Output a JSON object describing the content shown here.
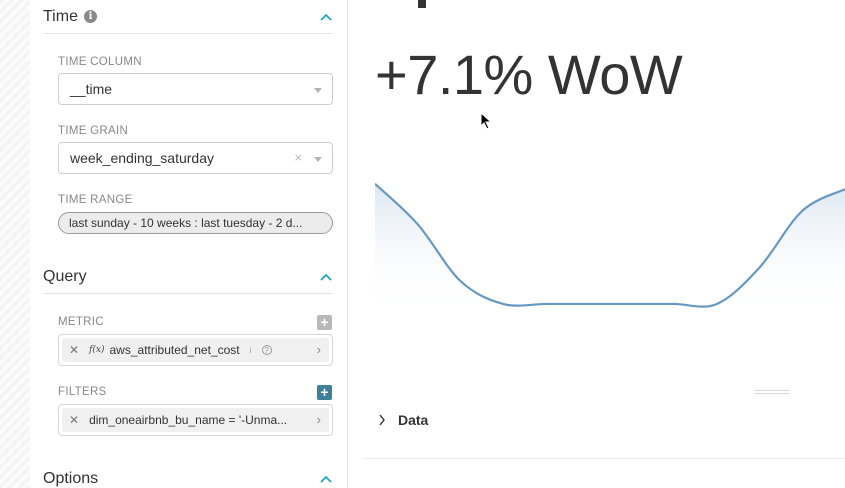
{
  "panel": {
    "time_section": {
      "title": "Time",
      "time_column": {
        "label": "TIME COLUMN",
        "value": "__time"
      },
      "time_grain": {
        "label": "TIME GRAIN",
        "value": "week_ending_saturday",
        "clear": "×"
      },
      "time_range": {
        "label": "TIME RANGE",
        "value": "last sunday - 10 weeks : last tuesday - 2 d..."
      }
    },
    "query_section": {
      "title": "Query",
      "metric": {
        "label": "METRIC",
        "fx": "f(x)",
        "value": "aws_attributed_net_cost",
        "remove": "✕",
        "info": "i",
        "help": "?"
      },
      "filters": {
        "label": "FILTERS",
        "value": "dim_oneairbnb_bu_name = '-Unma...",
        "remove": "✕"
      }
    },
    "options_section": {
      "title": "Options"
    }
  },
  "main": {
    "big_number": "+7.1% WoW",
    "data_toggle_label": "Data"
  },
  "colors": {
    "accent": "#20a7c9",
    "line": "#6699c2",
    "metric_add": "#b9b9b9",
    "filter_add": "#3e7f9a"
  },
  "chart_data": {
    "type": "area",
    "trend": [
      0.92,
      0.62,
      0.2,
      0.03,
      0.03,
      0.03,
      0.03,
      0.03,
      0.03,
      0.3,
      0.72,
      0.88
    ]
  }
}
